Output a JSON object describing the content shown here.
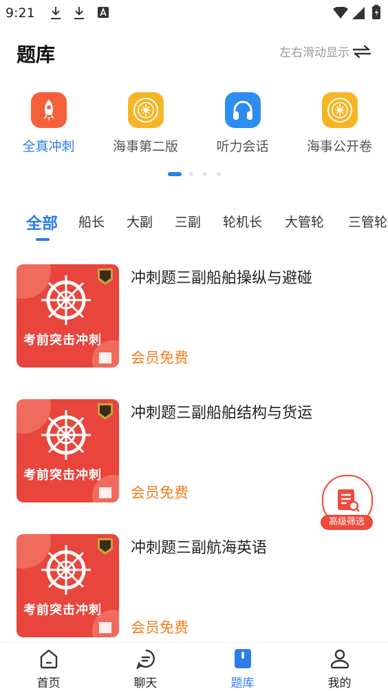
{
  "status": {
    "time": "9:21"
  },
  "header": {
    "title": "题库",
    "swipe_hint": "左右滑动显示"
  },
  "quick_actions": [
    {
      "label": "全真冲刺",
      "icon": "rocket-icon",
      "color": "#f5603a",
      "active": true
    },
    {
      "label": "海事第二版",
      "icon": "maritime-emblem-icon",
      "color": "#f5b525",
      "active": false
    },
    {
      "label": "听力会话",
      "icon": "headphones-icon",
      "color": "#2e8df0",
      "active": false
    },
    {
      "label": "海事公开卷",
      "icon": "maritime-emblem-icon",
      "color": "#f5b525",
      "active": false
    }
  ],
  "carousel": {
    "pages": 4,
    "current": 1
  },
  "tabs": [
    "全部",
    "船长",
    "大副",
    "三副",
    "轮机长",
    "大管轮",
    "三管轮"
  ],
  "active_tab": "全部",
  "items": [
    {
      "title": "冲刺题三副船舶操纵与避碰",
      "price": "会员免费",
      "cover_text": "考前突击冲刺"
    },
    {
      "title": "冲刺题三副船舶结构与货运",
      "price": "会员免费",
      "cover_text": "考前突击冲刺"
    },
    {
      "title": "冲刺题三副航海英语",
      "price": "会员免费",
      "cover_text": "考前突击冲刺"
    }
  ],
  "fab": {
    "label": "高级筛选"
  },
  "bottom_nav": [
    {
      "label": "首页",
      "icon": "home-icon"
    },
    {
      "label": "聊天",
      "icon": "chat-icon"
    },
    {
      "label": "题库",
      "icon": "question-bank-icon",
      "active": true
    },
    {
      "label": "我的",
      "icon": "profile-icon"
    }
  ],
  "colors": {
    "accent": "#2b7de9",
    "price": "#f47c1f",
    "cover": "#e8453c"
  }
}
